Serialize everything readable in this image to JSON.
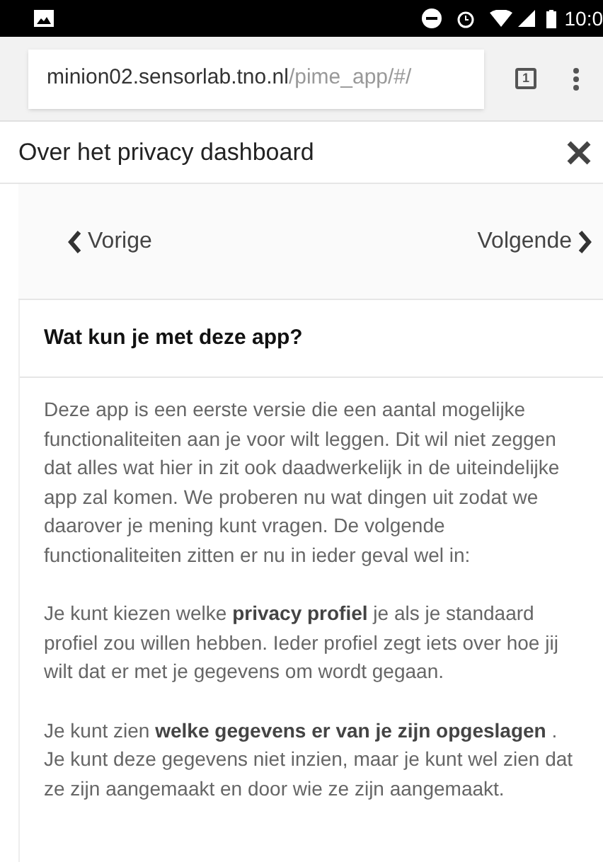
{
  "status_bar": {
    "time": "10:0"
  },
  "browser": {
    "url_host": "minion02.sensorlab.tno.nl",
    "url_path": "/pime_app/#/",
    "tab_count": "1"
  },
  "dialog": {
    "title": "Over het privacy dashboard"
  },
  "nav": {
    "previous": "Vorige",
    "next": "Volgende"
  },
  "section": {
    "heading": "Wat kun je met deze app?",
    "paragraphs": [
      "Deze app is een eerste versie die een aantal mogelijke functionaliteiten aan je voor wilt leggen. Dit wil niet zeggen dat alles wat hier in zit ook daadwerkelijk in de uiteindelijke app zal komen. We proberen nu wat dingen uit zodat we daarover je mening kunt vragen. De volgende functionaliteiten zitten er nu in ieder geval wel in:",
      "Je kunt kiezen welke **privacy profiel** je als je standaard profiel zou willen hebben. Ieder profiel zegt iets over hoe jij wilt dat er met je gegevens om wordt gegaan.",
      "Je kunt zien **welke gegevens er van je zijn opgeslagen** . Je kunt deze gegevens niet inzien, maar je kunt wel zien dat ze zijn aangemaakt en door wie ze zijn aangemaakt."
    ]
  }
}
